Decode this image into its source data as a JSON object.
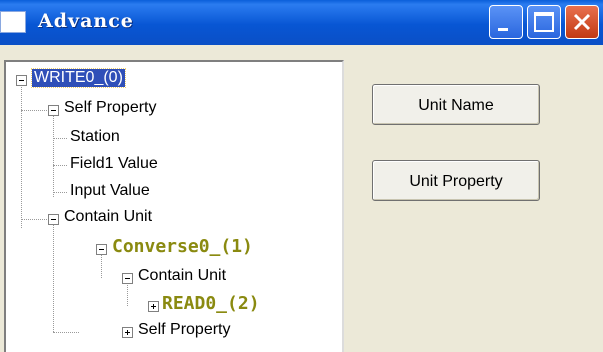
{
  "window": {
    "title": "Advance",
    "icon": "app-icon",
    "controls": [
      "minimize-icon",
      "maximize-icon",
      "close-icon"
    ]
  },
  "tree": {
    "root": {
      "label": "WRITE0_(0)",
      "selected": true,
      "expanded": true
    },
    "self_property": {
      "label": "Self Property",
      "expanded": true
    },
    "station": {
      "label": "Station"
    },
    "field1_value": {
      "label": "Field1 Value"
    },
    "input_value": {
      "label": "Input Value"
    },
    "contain_unit": {
      "label": "Contain Unit",
      "expanded": true
    },
    "converse": {
      "label": "Converse0_(1)",
      "expanded": true
    },
    "converse_contain_unit": {
      "label": "Contain Unit",
      "expanded": true
    },
    "read": {
      "label": "READ0_(2)",
      "expanded": false
    },
    "converse_self_property": {
      "label": "Self Property",
      "expanded": false
    }
  },
  "buttons": {
    "unit_name": "Unit Name",
    "unit_property": "Unit Property"
  },
  "colors": {
    "titlebar": "#0a56d4",
    "selection": "#2f4fb8",
    "unit_label": "#8a8a10",
    "close_button": "#d2461c"
  }
}
